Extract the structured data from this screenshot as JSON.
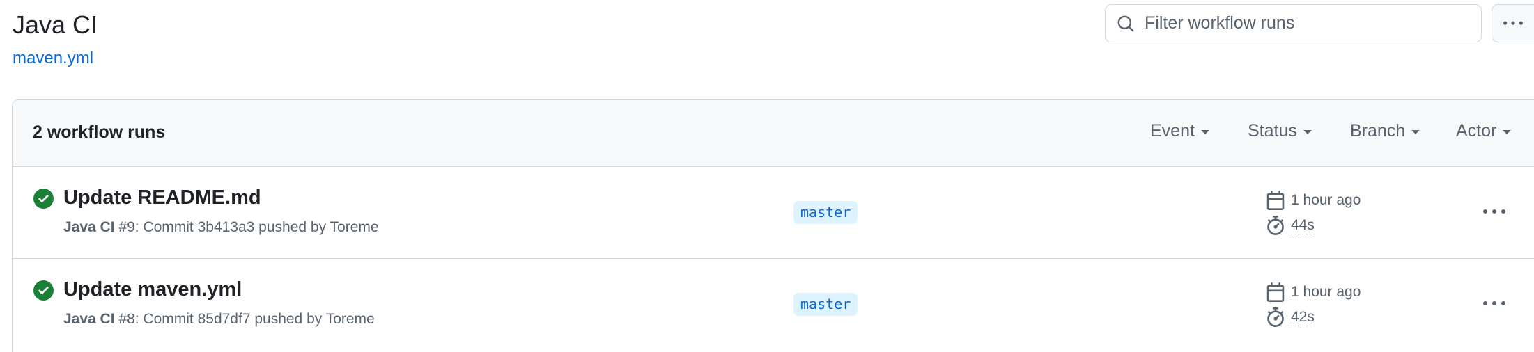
{
  "workflow": {
    "title": "Java CI",
    "file": "maven.yml"
  },
  "search": {
    "placeholder": "Filter workflow runs"
  },
  "runs_header": {
    "count_label": "2 workflow runs",
    "filters": {
      "event": "Event",
      "status": "Status",
      "branch": "Branch",
      "actor": "Actor"
    }
  },
  "runs": [
    {
      "title": "Update README.md",
      "workflow_name": "Java CI",
      "meta": " #9: Commit 3b413a3 pushed by Toreme",
      "branch": "master",
      "time_ago": "1 hour ago",
      "duration": "44s",
      "status": "success"
    },
    {
      "title": "Update maven.yml",
      "workflow_name": "Java CI",
      "meta": " #8: Commit 85d7df7 pushed by Toreme",
      "branch": "master",
      "time_ago": "1 hour ago",
      "duration": "42s",
      "status": "success"
    }
  ],
  "colors": {
    "success": "#1a7f37",
    "link": "#0969da",
    "muted": "#59636e",
    "border": "#d0d7de",
    "header_bg": "#f6f8fa",
    "branch_bg": "#ddf4ff"
  },
  "icons": {
    "search": "search-icon",
    "kebab": "kebab-horizontal-icon",
    "success": "check-circle-fill-icon",
    "calendar": "calendar-icon",
    "stopwatch": "stopwatch-icon"
  }
}
